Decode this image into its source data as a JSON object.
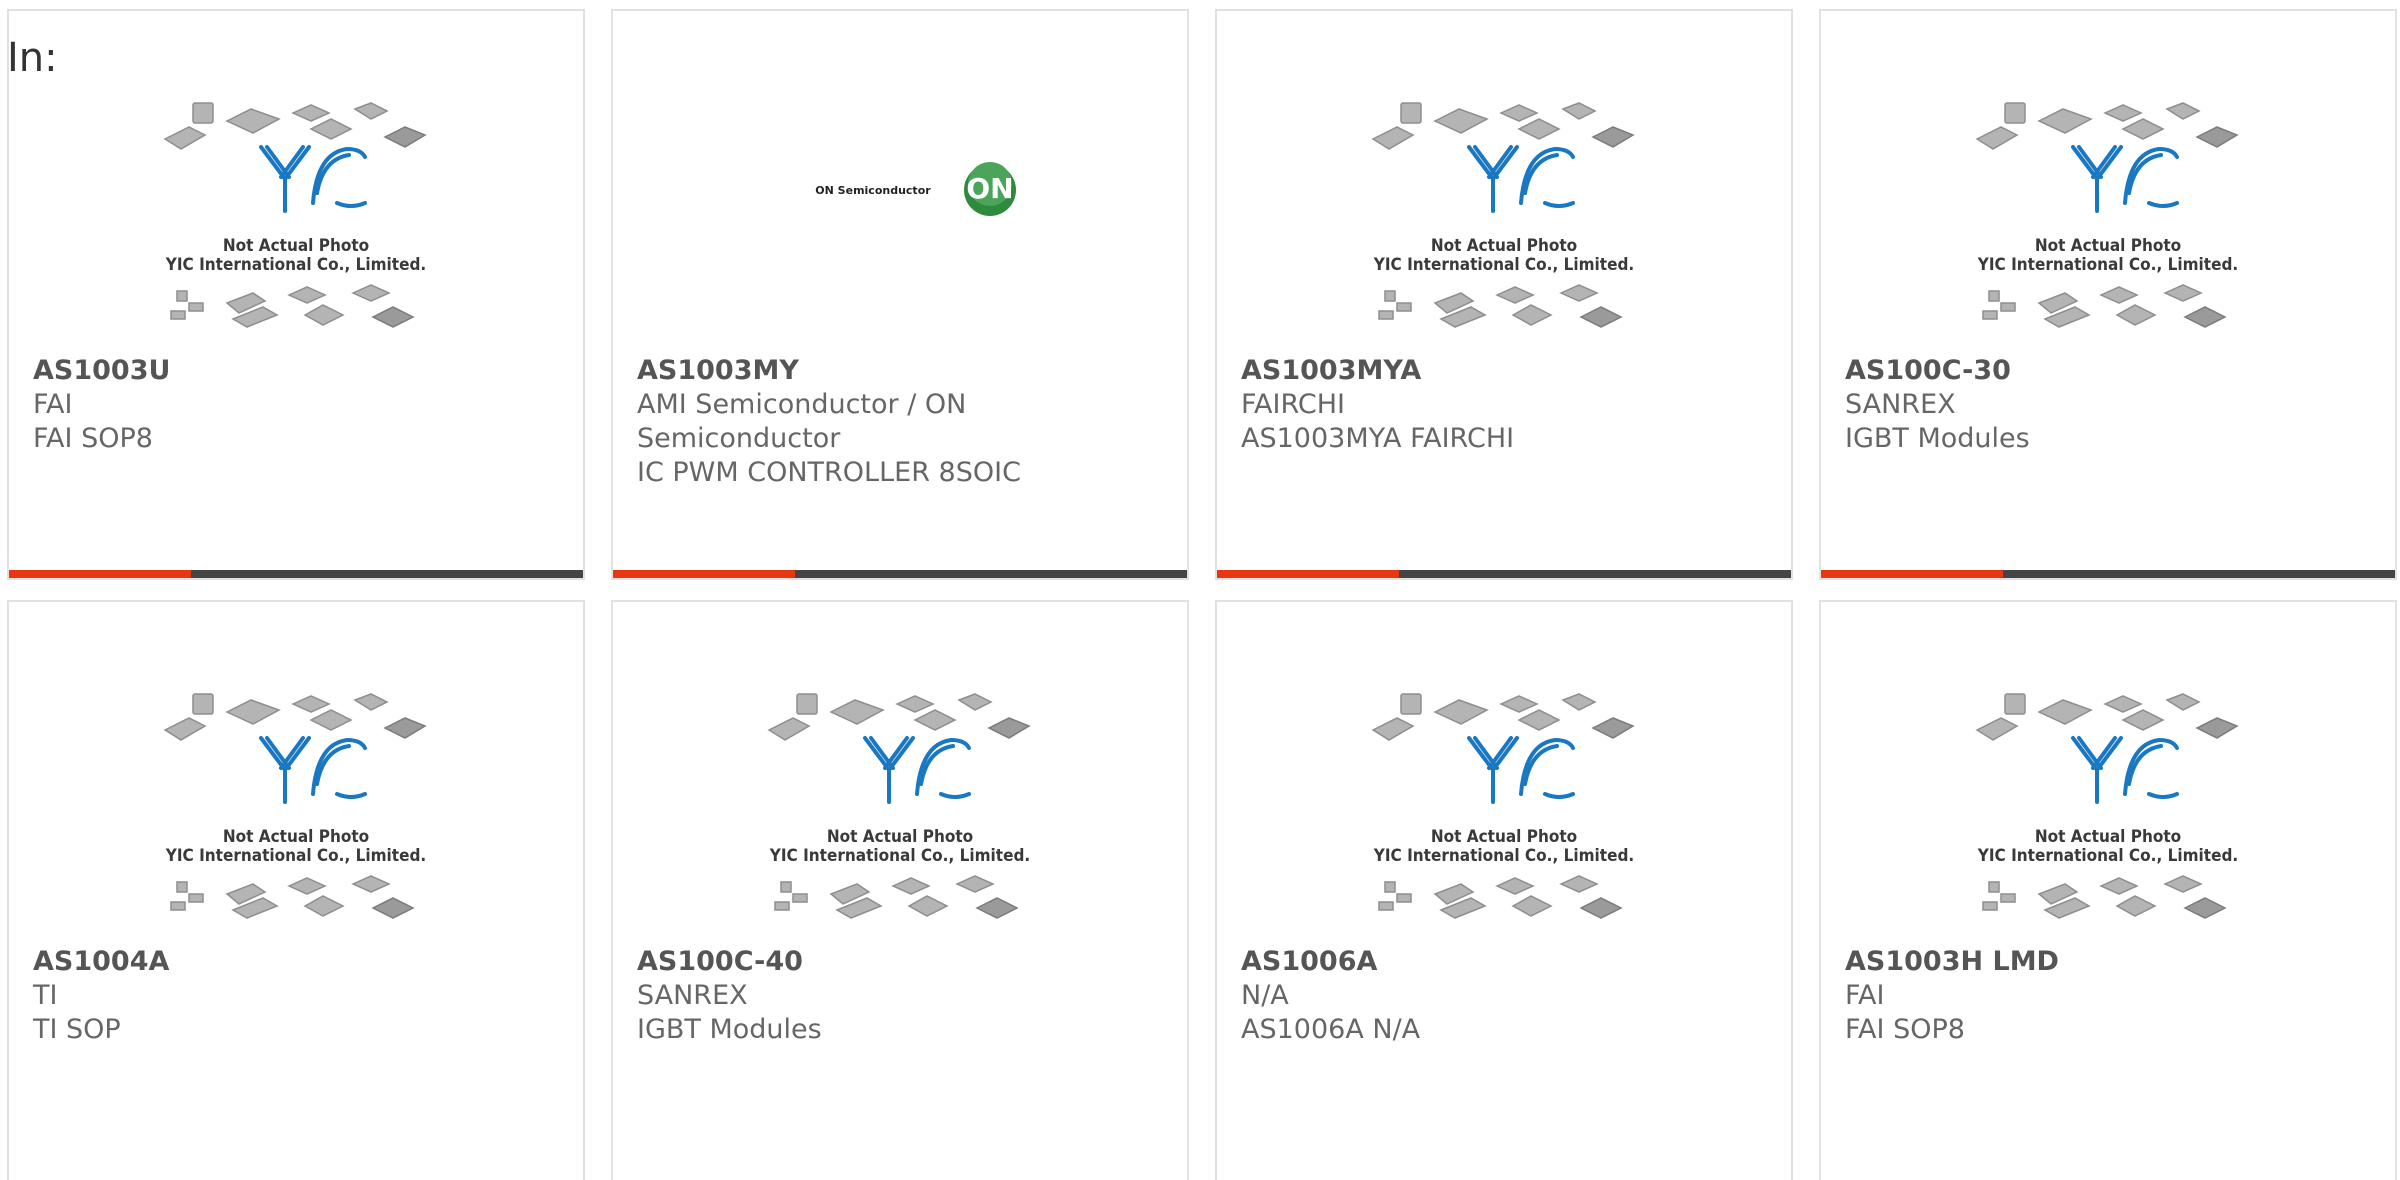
{
  "header": {
    "in_label": "In:"
  },
  "placeholder": {
    "line1": "Not Actual Photo",
    "line2": "YIC International Co., Limited."
  },
  "on_logo": {
    "text": "ON Semiconductor",
    "mark": "ON"
  },
  "products": [
    {
      "part_number": "AS1003U",
      "manufacturer": "FAI",
      "description": "FAI SOP8",
      "image": "yic-placeholder"
    },
    {
      "part_number": "AS1003MY",
      "manufacturer": "AMI Semiconductor / ON Semiconductor",
      "description": "IC PWM CONTROLLER 8SOIC",
      "image": "on-semiconductor-logo"
    },
    {
      "part_number": "AS1003MYA",
      "manufacturer": "FAIRCHI",
      "description": "AS1003MYA FAIRCHI",
      "image": "yic-placeholder"
    },
    {
      "part_number": "AS100C-30",
      "manufacturer": "SANREX",
      "description": "IGBT Modules",
      "image": "yic-placeholder"
    },
    {
      "part_number": "AS1004A",
      "manufacturer": "TI",
      "description": "TI SOP",
      "image": "yic-placeholder"
    },
    {
      "part_number": "AS100C-40",
      "manufacturer": "SANREX",
      "description": "IGBT Modules",
      "image": "yic-placeholder"
    },
    {
      "part_number": "AS1006A",
      "manufacturer": "N/A",
      "description": "AS1006A N/A",
      "image": "yic-placeholder"
    },
    {
      "part_number": "AS1003H LMD",
      "manufacturer": "FAI",
      "description": "FAI SOP8",
      "image": "yic-placeholder"
    }
  ],
  "colors": {
    "accent": "#e63612",
    "bar": "#444444",
    "border": "#e1e1e1",
    "logo_blue": "#1a78c2",
    "on_green": "#2e8b3e"
  }
}
